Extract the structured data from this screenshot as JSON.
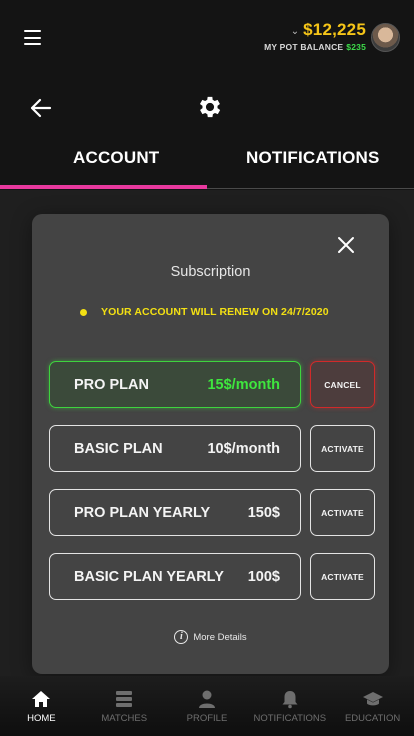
{
  "topbar": {
    "balance": "$12,225",
    "pot_label": "MY POT BALANCE",
    "pot_amount": "$235"
  },
  "tabs": [
    {
      "label": "ACCOUNT",
      "active": true
    },
    {
      "label": "NOTIFICATIONS",
      "active": false
    }
  ],
  "modal": {
    "title": "Subscription",
    "renew_text": "YOUR ACCOUNT WILL RENEW ON 24/7/2020",
    "plans": [
      {
        "name": "PRO PLAN",
        "price": "15$/month",
        "button": "CANCEL",
        "active": true
      },
      {
        "name": "BASIC PLAN",
        "price": "10$/month",
        "button": "ACTIVATE",
        "active": false
      },
      {
        "name": "PRO PLAN YEARLY",
        "price": "150$",
        "button": "ACTIVATE",
        "active": false
      },
      {
        "name": "BASIC PLAN YEARLY",
        "price": "100$",
        "button": "ACTIVATE",
        "active": false
      }
    ],
    "details_label": "More Details"
  },
  "nav": [
    {
      "label": "HOME",
      "icon": "home-icon",
      "active": true
    },
    {
      "label": "MATCHES",
      "icon": "matches-icon",
      "active": false
    },
    {
      "label": "PROFILE",
      "icon": "profile-icon",
      "active": false
    },
    {
      "label": "NOTIFICATIONS",
      "icon": "bell-icon",
      "active": false
    },
    {
      "label": "EDUCATION",
      "icon": "graduation-cap-icon",
      "active": false
    }
  ],
  "colors": {
    "accent_pink": "#e8399e",
    "balance_gold": "#f5c518",
    "pot_green": "#3ddc4a",
    "renew_yellow": "#f3e013",
    "active_green": "#3ed43e",
    "cancel_red": "#d12a2a"
  }
}
